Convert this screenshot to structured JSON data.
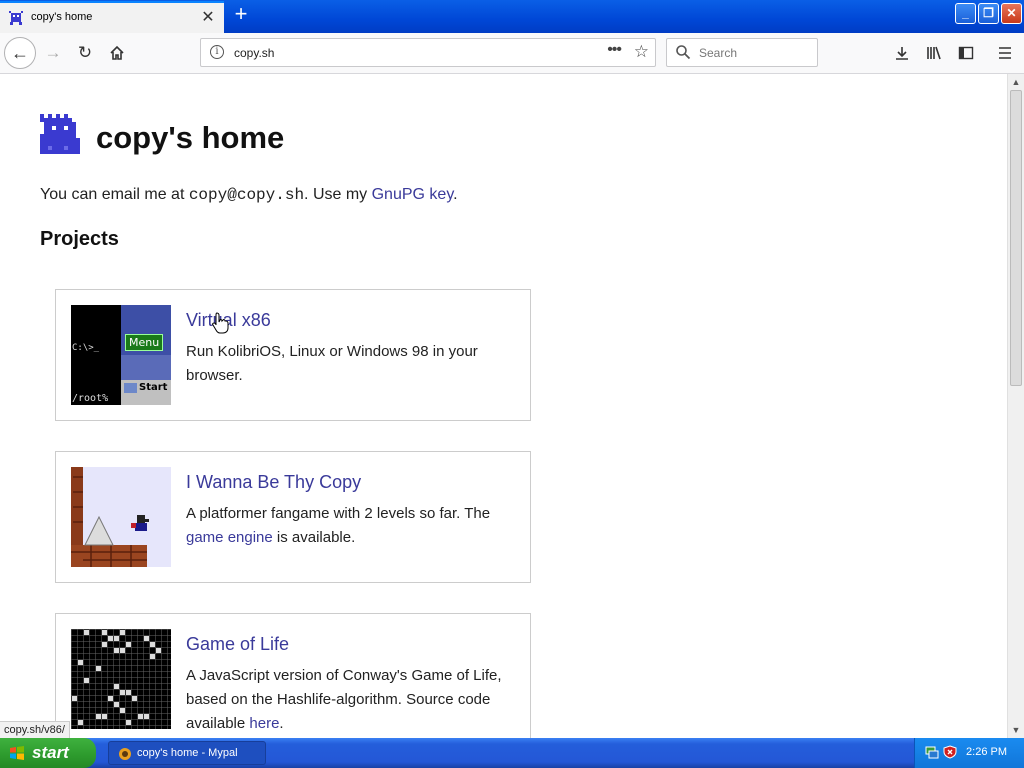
{
  "browser": {
    "tab_title": "copy's home",
    "url": "copy.sh",
    "search_placeholder": "Search",
    "status_url": "copy.sh/v86/"
  },
  "page": {
    "heading": "copy's home",
    "intro_prefix": "You can email me at ",
    "email": "copy@copy.sh",
    "intro_middle": ". Use my ",
    "gpg_link": "GnuPG key",
    "intro_suffix": ".",
    "projects_heading": "Projects",
    "projects": [
      {
        "title": "Virtual x86",
        "desc": "Run KolibriOS, Linux or Windows 98 in your browser.",
        "thumb": {
          "prompt": "C:\\>_",
          "root": "/root%",
          "menu": "Menu",
          "start": "Start"
        }
      },
      {
        "title": "I Wanna Be Thy Copy",
        "desc_prefix": "A platformer fangame with 2 levels so far. The ",
        "desc_link": "game engine",
        "desc_suffix": " is available."
      },
      {
        "title": "Game of Life",
        "desc_prefix": "A JavaScript version of Conway's Game of Life, based on the Hashlife-algorithm. Source code available ",
        "desc_link": "here",
        "desc_suffix": "."
      }
    ]
  },
  "taskbar": {
    "start_label": "start",
    "task_label": "copy's home - Mypal",
    "clock": "2:26 PM"
  },
  "colors": {
    "link": "#3a3a9a",
    "xp_blue": "#245edb",
    "start_green": "#3fb13f"
  }
}
